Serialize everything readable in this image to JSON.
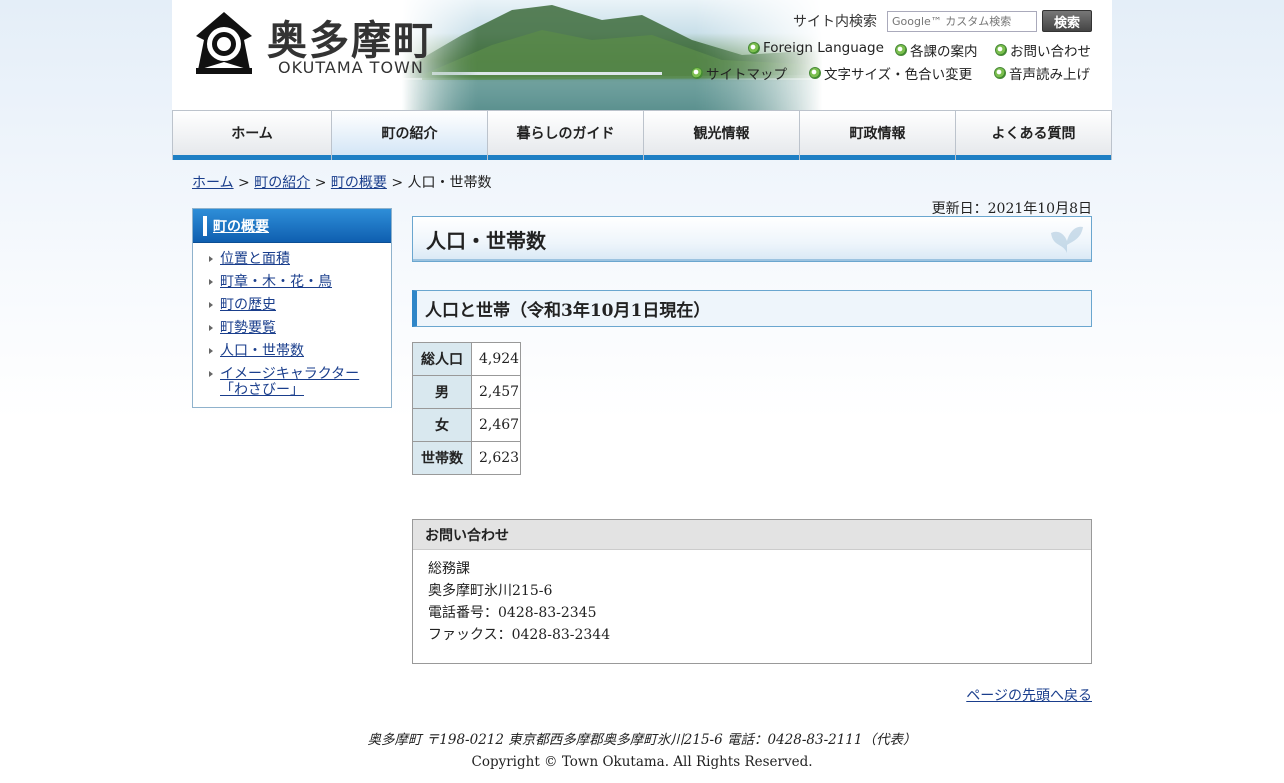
{
  "header": {
    "logo_jp": "奥多摩町",
    "logo_en": "OKUTAMA TOWN",
    "search_label": "サイト内検索",
    "search_placeholder": "Google™ カスタム検索",
    "search_button": "検索",
    "util_links": [
      "Foreign Language",
      "各課の案内",
      "お問い合わせ",
      "サイトマップ",
      "文字サイズ・色合い変更",
      "音声読み上げ"
    ]
  },
  "nav": {
    "items": [
      "ホーム",
      "町の紹介",
      "暮らしのガイド",
      "観光情報",
      "町政情報",
      "よくある質問"
    ],
    "active_index": 1
  },
  "breadcrumb": {
    "links": [
      "ホーム",
      "町の紹介",
      "町の概要"
    ],
    "separator": ">",
    "current": "人口・世帯数"
  },
  "sidebar": {
    "title": "町の概要",
    "items": [
      "位置と面積",
      "町章・木・花・鳥",
      "町の歴史",
      "町勢要覧",
      "人口・世帯数",
      "イメージキャラクター「わさびー」"
    ]
  },
  "main": {
    "updated": "更新日：2021年10月8日",
    "title": "人口・世帯数",
    "section_title": "人口と世帯（令和3年10月1日現在）",
    "table": [
      {
        "label": "総人口",
        "value": "4,924"
      },
      {
        "label": "男",
        "value": "2,457"
      },
      {
        "label": "女",
        "value": "2,467"
      },
      {
        "label": "世帯数",
        "value": "2,623"
      }
    ],
    "contact": {
      "heading": "お問い合わせ",
      "department": "総務課",
      "address": "奥多摩町氷川215-6",
      "phone": "電話番号：0428-83-2345",
      "fax": "ファックス：0428-83-2344"
    },
    "back_to_top": "ページの先頭へ戻る"
  },
  "footer": {
    "address": "奥多摩町 〒198-0212 東京都西多摩郡奥多摩町氷川215-6 電話：0428-83-2111（代表）",
    "copyright": "Copyright © Town Okutama. All Rights Reserved."
  },
  "colors": {
    "nav_accent": "#1e7fc4",
    "sidebar_head": "#0f5fb0",
    "link": "#1a3e8c",
    "table_header": "#d9e8ef"
  }
}
